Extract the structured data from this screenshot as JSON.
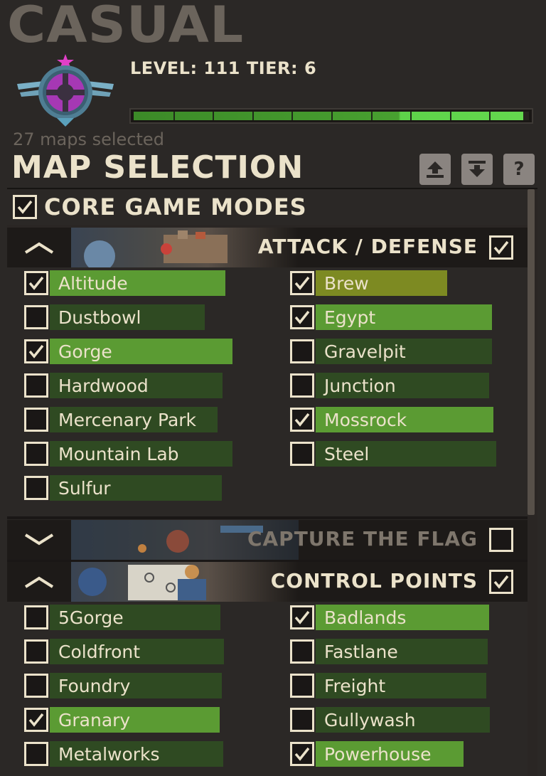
{
  "header": {
    "mode_title": "CASUAL",
    "level_text": "LEVEL: 111 TIER: 6",
    "xp_progress": 0.985,
    "maps_selected": "27 maps selected",
    "section_title": "MAP SELECTION"
  },
  "buttons": {
    "upload_icon": "upload-icon",
    "download_icon": "download-icon",
    "help_label": "?"
  },
  "core": {
    "label": "CORE GAME MODES",
    "checked": true
  },
  "categories": {
    "attack_defense": {
      "label": "ATTACK / DEFENSE",
      "checked": true,
      "expanded": true,
      "maps": [
        {
          "name": "Altitude",
          "checked": true
        },
        {
          "name": "Brew",
          "checked": true
        },
        {
          "name": "Dustbowl",
          "checked": false
        },
        {
          "name": "Egypt",
          "checked": true
        },
        {
          "name": "Gorge",
          "checked": true
        },
        {
          "name": "Gravelpit",
          "checked": false
        },
        {
          "name": "Hardwood",
          "checked": false
        },
        {
          "name": "Junction",
          "checked": false
        },
        {
          "name": "Mercenary Park",
          "checked": false
        },
        {
          "name": "Mossrock",
          "checked": true
        },
        {
          "name": "Mountain Lab",
          "checked": false
        },
        {
          "name": "Steel",
          "checked": false
        },
        {
          "name": "Sulfur",
          "checked": false
        }
      ]
    },
    "ctf": {
      "label": "CAPTURE THE FLAG",
      "checked": false,
      "expanded": false
    },
    "control_points": {
      "label": "CONTROL POINTS",
      "checked": true,
      "expanded": true,
      "maps": [
        {
          "name": "5Gorge",
          "checked": false
        },
        {
          "name": "Badlands",
          "checked": true
        },
        {
          "name": "Coldfront",
          "checked": false
        },
        {
          "name": "Fastlane",
          "checked": false
        },
        {
          "name": "Foundry",
          "checked": false
        },
        {
          "name": "Freight",
          "checked": false
        },
        {
          "name": "Granary",
          "checked": true
        },
        {
          "name": "Gullywash",
          "checked": false
        },
        {
          "name": "Metalworks",
          "checked": false
        },
        {
          "name": "Powerhouse",
          "checked": true
        }
      ]
    }
  },
  "colors": {
    "selected_bar": "#5b9b33",
    "unselected_bar": "#2f4a22",
    "text": "#ebe2ca",
    "background": "#2b2826"
  }
}
